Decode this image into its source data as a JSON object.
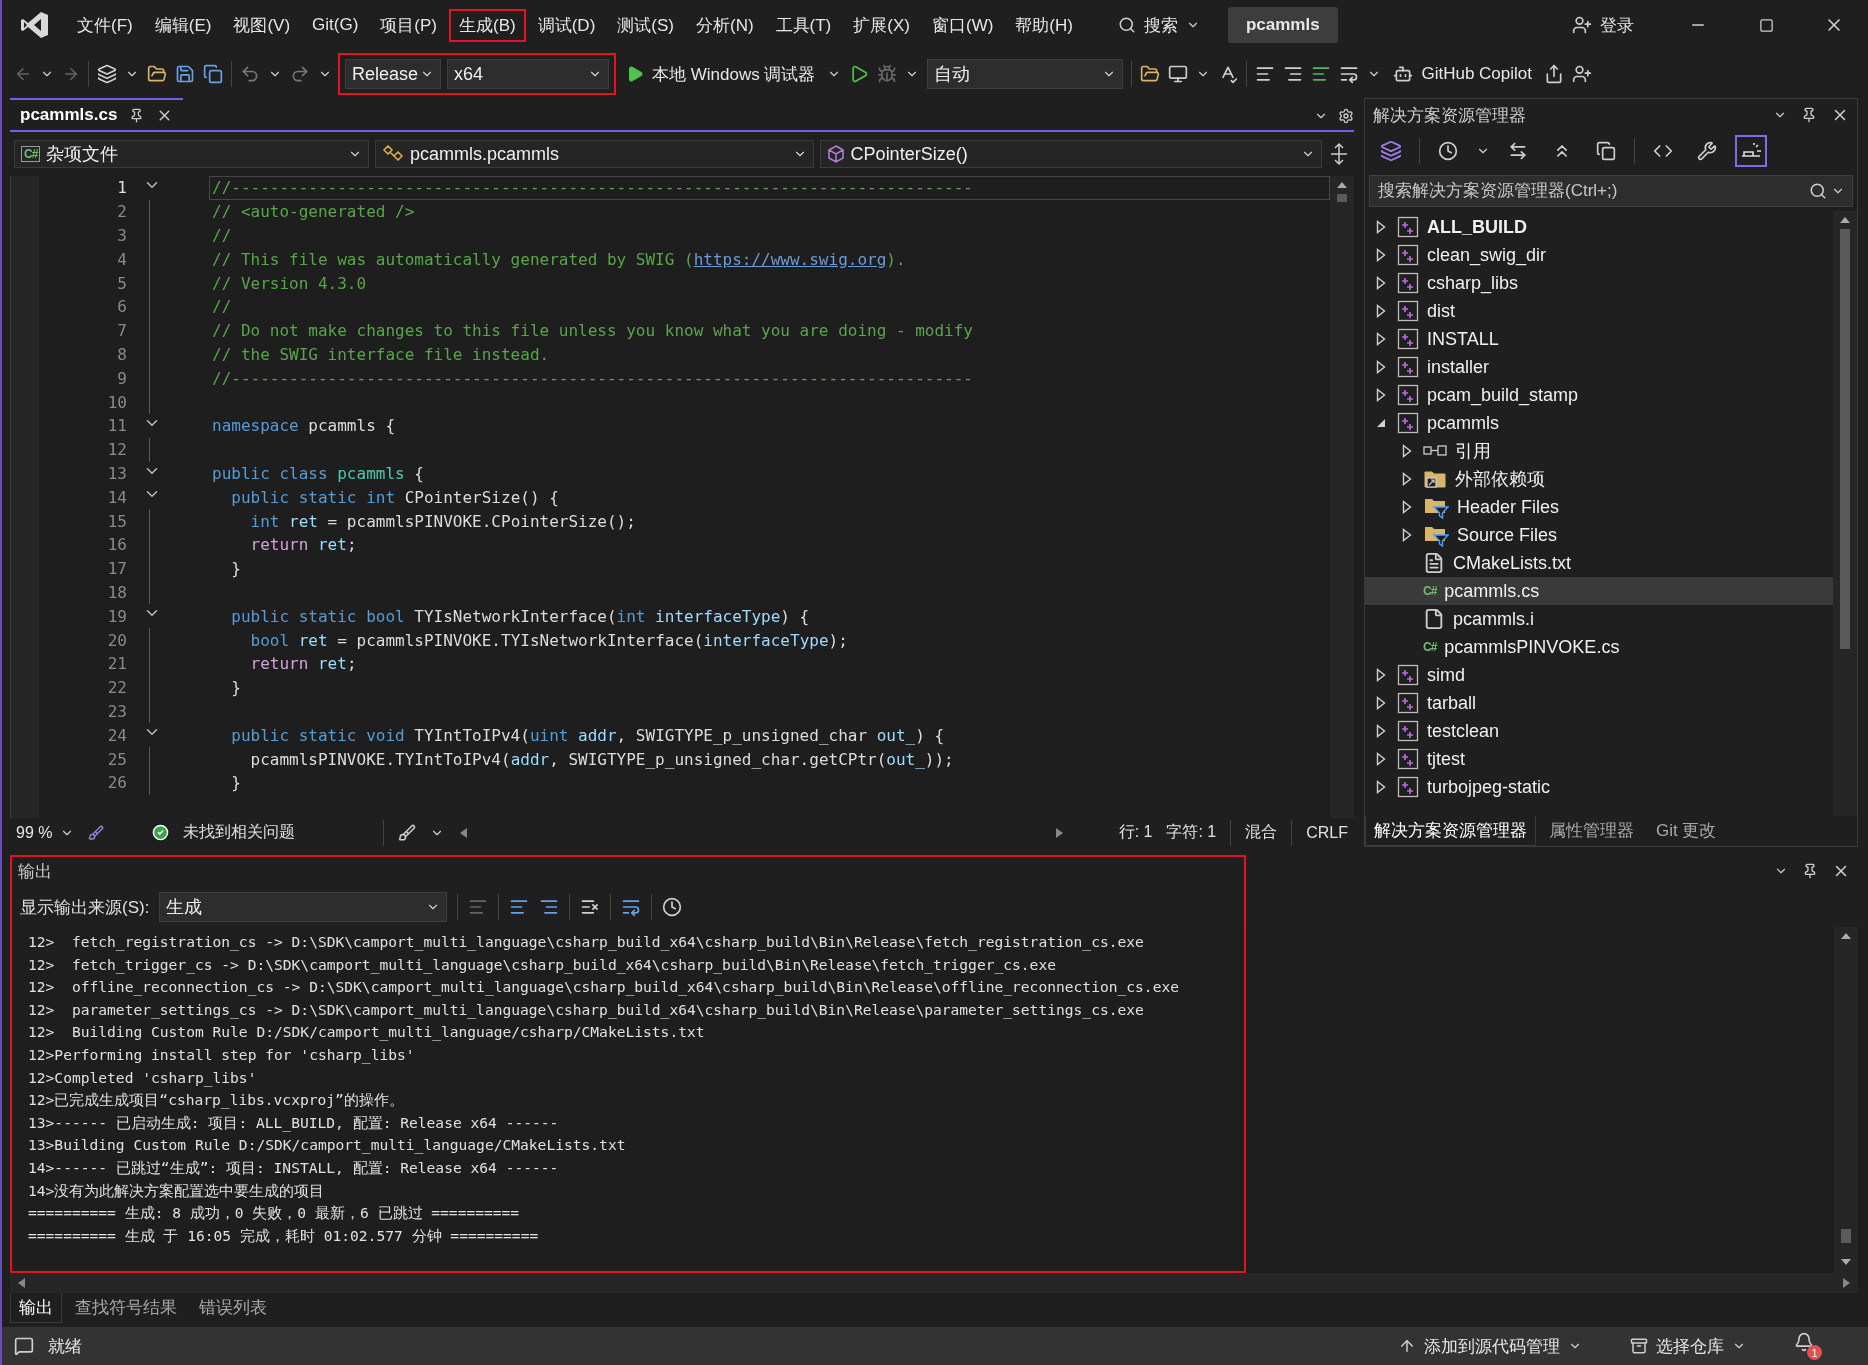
{
  "title_bar": {
    "menus": [
      {
        "label": "文件(F)",
        "highlighted": false
      },
      {
        "label": "编辑(E)",
        "highlighted": false
      },
      {
        "label": "视图(V)",
        "highlighted": false
      },
      {
        "label": "Git(G)",
        "highlighted": false
      },
      {
        "label": "项目(P)",
        "highlighted": false
      },
      {
        "label": "生成(B)",
        "highlighted": true
      },
      {
        "label": "调试(D)",
        "highlighted": false
      },
      {
        "label": "测试(S)",
        "highlighted": false
      },
      {
        "label": "分析(N)",
        "highlighted": false
      },
      {
        "label": "工具(T)",
        "highlighted": false
      },
      {
        "label": "扩展(X)",
        "highlighted": false
      },
      {
        "label": "窗口(W)",
        "highlighted": false
      },
      {
        "label": "帮助(H)",
        "highlighted": false
      }
    ],
    "search": "搜索",
    "solution": "pcammls",
    "login": "登录"
  },
  "toolbar": {
    "configuration": "Release",
    "platform": "x64",
    "highlighted": true,
    "debugger": "本地 Windows 调试器",
    "target": "自动",
    "copilot": "GitHub Copilot"
  },
  "document_tabs": [
    {
      "label": "pcammls.cs",
      "selected": true
    }
  ],
  "nav_bar": {
    "badge": "C#",
    "project": "杂项文件",
    "type": "pcammls.pcammls",
    "member": "CPointerSize()"
  },
  "code_lines": [
    {
      "number": "1",
      "foldable": true,
      "current": true,
      "tokens": [
        {
          "kind": "comment",
          "text": "//-----------------------------------------------------------------------------"
        }
      ]
    },
    {
      "number": "2",
      "foldable": false,
      "current": false,
      "tokens": [
        {
          "kind": "comment",
          "text": "// <auto-generated />"
        }
      ]
    },
    {
      "number": "3",
      "foldable": false,
      "current": false,
      "tokens": [
        {
          "kind": "comment",
          "text": "//"
        }
      ]
    },
    {
      "number": "4",
      "foldable": false,
      "current": false,
      "tokens": [
        {
          "kind": "comment",
          "text": "// This file was automatically generated by SWIG ("
        },
        {
          "kind": "link",
          "text": "https://www.swig.org"
        },
        {
          "kind": "comment",
          "text": ")."
        }
      ]
    },
    {
      "number": "5",
      "foldable": false,
      "current": false,
      "tokens": [
        {
          "kind": "comment",
          "text": "// Version 4.3.0"
        }
      ]
    },
    {
      "number": "6",
      "foldable": false,
      "current": false,
      "tokens": [
        {
          "kind": "comment",
          "text": "//"
        }
      ]
    },
    {
      "number": "7",
      "foldable": false,
      "current": false,
      "tokens": [
        {
          "kind": "comment",
          "text": "// Do not make changes to this file unless you know what you are doing - modify"
        }
      ]
    },
    {
      "number": "8",
      "foldable": false,
      "current": false,
      "tokens": [
        {
          "kind": "comment",
          "text": "// the SWIG interface file instead."
        }
      ]
    },
    {
      "number": "9",
      "foldable": false,
      "current": false,
      "tokens": [
        {
          "kind": "comment",
          "text": "//-----------------------------------------------------------------------------"
        }
      ]
    },
    {
      "number": "10",
      "foldable": false,
      "current": false
    },
    {
      "number": "11",
      "foldable": true,
      "current": false,
      "tokens": [
        {
          "kind": "keyword",
          "text": "namespace"
        },
        {
          "kind": "plain",
          "text": " pcammls {"
        }
      ]
    },
    {
      "number": "12",
      "foldable": false,
      "current": false
    },
    {
      "number": "13",
      "foldable": true,
      "current": false,
      "tokens": [
        {
          "kind": "keyword",
          "text": "public class "
        },
        {
          "kind": "class",
          "text": "pcammls"
        },
        {
          "kind": "plain",
          "text": " {"
        }
      ]
    },
    {
      "number": "14",
      "foldable": true,
      "current": false,
      "tokens": [
        {
          "kind": "keyword",
          "text": "  public static int"
        },
        {
          "kind": "plain",
          "text": " CPointerSize() {"
        }
      ]
    },
    {
      "number": "15",
      "foldable": false,
      "current": false,
      "tokens": [
        {
          "kind": "keyword",
          "text": "    int "
        },
        {
          "kind": "variable",
          "text": "ret"
        },
        {
          "kind": "plain",
          "text": " = pcammlsPINVOKE.CPointerSize();"
        }
      ]
    },
    {
      "number": "16",
      "foldable": false,
      "current": false,
      "tokens": [
        {
          "kind": "control",
          "text": "    return "
        },
        {
          "kind": "variable",
          "text": "ret"
        },
        {
          "kind": "plain",
          "text": ";"
        }
      ]
    },
    {
      "number": "17",
      "foldable": false,
      "current": false,
      "tokens": [
        {
          "kind": "plain",
          "text": "  }"
        }
      ]
    },
    {
      "number": "18",
      "foldable": false,
      "current": false
    },
    {
      "number": "19",
      "foldable": true,
      "current": false,
      "tokens": [
        {
          "kind": "keyword",
          "text": "  public static bool"
        },
        {
          "kind": "plain",
          "text": " TYIsNetworkInterface("
        },
        {
          "kind": "keyword",
          "text": "int "
        },
        {
          "kind": "variable",
          "text": "interfaceType"
        },
        {
          "kind": "plain",
          "text": ") {"
        }
      ]
    },
    {
      "number": "20",
      "foldable": false,
      "current": false,
      "tokens": [
        {
          "kind": "keyword",
          "text": "    bool "
        },
        {
          "kind": "variable",
          "text": "ret"
        },
        {
          "kind": "plain",
          "text": " = pcammlsPINVOKE.TYIsNetworkInterface("
        },
        {
          "kind": "variable",
          "text": "interfaceType"
        },
        {
          "kind": "plain",
          "text": ");"
        }
      ]
    },
    {
      "number": "21",
      "foldable": false,
      "current": false,
      "tokens": [
        {
          "kind": "control",
          "text": "    return "
        },
        {
          "kind": "variable",
          "text": "ret"
        },
        {
          "kind": "plain",
          "text": ";"
        }
      ]
    },
    {
      "number": "22",
      "foldable": false,
      "current": false,
      "tokens": [
        {
          "kind": "plain",
          "text": "  }"
        }
      ]
    },
    {
      "number": "23",
      "foldable": false,
      "current": false
    },
    {
      "number": "24",
      "foldable": true,
      "current": false,
      "tokens": [
        {
          "kind": "keyword",
          "text": "  public static void"
        },
        {
          "kind": "plain",
          "text": " TYIntToIPv4("
        },
        {
          "kind": "keyword",
          "text": "uint "
        },
        {
          "kind": "variable",
          "text": "addr"
        },
        {
          "kind": "plain",
          "text": ", SWIGTYPE_p_unsigned_char "
        },
        {
          "kind": "variable",
          "text": "out_"
        },
        {
          "kind": "plain",
          "text": ") {"
        }
      ]
    },
    {
      "number": "25",
      "foldable": false,
      "current": false,
      "tokens": [
        {
          "kind": "plain",
          "text": "    pcammlsPINVOKE.TYIntToIPv4("
        },
        {
          "kind": "variable",
          "text": "addr"
        },
        {
          "kind": "plain",
          "text": ", SWIGTYPE_p_unsigned_char.getCPtr("
        },
        {
          "kind": "variable",
          "text": "out_"
        },
        {
          "kind": "plain",
          "text": "));"
        }
      ]
    },
    {
      "number": "26",
      "foldable": false,
      "current": false,
      "tokens": [
        {
          "kind": "plain",
          "text": "  }"
        }
      ]
    }
  ],
  "editor_status": {
    "zoom": "99 %",
    "issues": "未找到相关问题",
    "line": "行: 1",
    "column": "字符: 1",
    "indentation": "混合",
    "line_ending": "CRLF"
  },
  "solution_explorer": {
    "title": "解决方案资源管理器",
    "search": {
      "placeholder": "搜索解决方案资源管理器(Ctrl+;)"
    },
    "items": [
      {
        "label": "ALL_BUILD",
        "kind": "project",
        "expanded": false,
        "startup": true,
        "selected": false
      },
      {
        "label": "clean_swig_dir",
        "kind": "project",
        "expanded": false,
        "startup": false,
        "selected": false
      },
      {
        "label": "csharp_libs",
        "kind": "project",
        "expanded": false,
        "startup": false,
        "selected": false
      },
      {
        "label": "dist",
        "kind": "project",
        "expanded": false,
        "startup": false,
        "selected": false
      },
      {
        "label": "INSTALL",
        "kind": "project",
        "expanded": false,
        "startup": false,
        "selected": false
      },
      {
        "label": "installer",
        "kind": "project",
        "expanded": false,
        "startup": false,
        "selected": false
      },
      {
        "label": "pcam_build_stamp",
        "kind": "project",
        "expanded": false,
        "startup": false,
        "selected": false
      },
      {
        "label": "pcammls",
        "kind": "project",
        "expanded": true,
        "startup": false,
        "selected": false,
        "children": [
          {
            "label": "引用",
            "kind": "references",
            "expanded": false,
            "selected": false
          },
          {
            "label": "外部依赖项",
            "kind": "external",
            "expanded": false,
            "selected": false
          },
          {
            "label": "Header Files",
            "kind": "filter",
            "expanded": false,
            "selected": false
          },
          {
            "label": "Source Files",
            "kind": "filter",
            "expanded": false,
            "selected": false
          },
          {
            "label": "CMakeLists.txt",
            "kind": "text-file",
            "selected": false
          },
          {
            "label": "pcammls.cs",
            "kind": "cs-file",
            "badge": "C#",
            "selected": true
          },
          {
            "label": "pcammls.i",
            "kind": "file",
            "selected": false
          },
          {
            "label": "pcammlsPINVOKE.cs",
            "kind": "cs-file",
            "badge": "C#",
            "selected": false
          }
        ]
      },
      {
        "label": "simd",
        "kind": "project",
        "expanded": false,
        "startup": false,
        "selected": false
      },
      {
        "label": "tarball",
        "kind": "project",
        "expanded": false,
        "startup": false,
        "selected": false
      },
      {
        "label": "testclean",
        "kind": "project",
        "expanded": false,
        "startup": false,
        "selected": false
      },
      {
        "label": "tjtest",
        "kind": "project",
        "expanded": false,
        "startup": false,
        "selected": false
      },
      {
        "label": "turbojpeg-static",
        "kind": "project",
        "expanded": false,
        "startup": false,
        "selected": false
      }
    ],
    "tabs": [
      {
        "label": "解决方案资源管理器",
        "selected": true
      },
      {
        "label": "属性管理器",
        "selected": false
      },
      {
        "label": "Git 更改",
        "selected": false
      }
    ]
  },
  "output": {
    "title": "输出",
    "highlighted": true,
    "source_label": "显示输出来源(S):",
    "source": "生成",
    "lines": [
      "12>  fetch_registration_cs -> D:\\SDK\\camport_multi_language\\csharp_build_x64\\csharp_build\\Bin\\Release\\fetch_registration_cs.exe",
      "12>  fetch_trigger_cs -> D:\\SDK\\camport_multi_language\\csharp_build_x64\\csharp_build\\Bin\\Release\\fetch_trigger_cs.exe",
      "12>  offline_reconnection_cs -> D:\\SDK\\camport_multi_language\\csharp_build_x64\\csharp_build\\Bin\\Release\\offline_reconnection_cs.exe",
      "12>  parameter_settings_cs -> D:\\SDK\\camport_multi_language\\csharp_build_x64\\csharp_build\\Bin\\Release\\parameter_settings_cs.exe",
      "12>  Building Custom Rule D:/SDK/camport_multi_language/csharp/CMakeLists.txt",
      "12>Performing install step for 'csharp_libs'",
      "12>Completed 'csharp_libs'",
      "12>已完成生成项目“csharp_libs.vcxproj”的操作。",
      "13>------ 已启动生成: 项目: ALL_BUILD, 配置: Release x64 ------",
      "13>Building Custom Rule D:/SDK/camport_multi_language/CMakeLists.txt",
      "14>------ 已跳过“生成”: 项目: INSTALL, 配置: Release x64 ------",
      "14>没有为此解决方案配置选中要生成的项目",
      "========== 生成: 8 成功，0 失败，0 最新，6 已跳过 ==========",
      "========== 生成 于 16:05 完成，耗时 01:02.577 分钟 =========="
    ],
    "tabs": [
      {
        "label": "输出",
        "selected": true
      },
      {
        "label": "查找符号结果",
        "selected": false
      },
      {
        "label": "错误列表",
        "selected": false
      }
    ]
  },
  "status_bar": {
    "message": "就绪",
    "source_control": "添加到源代码管理",
    "repository": "选择仓库",
    "notifications": "1"
  }
}
